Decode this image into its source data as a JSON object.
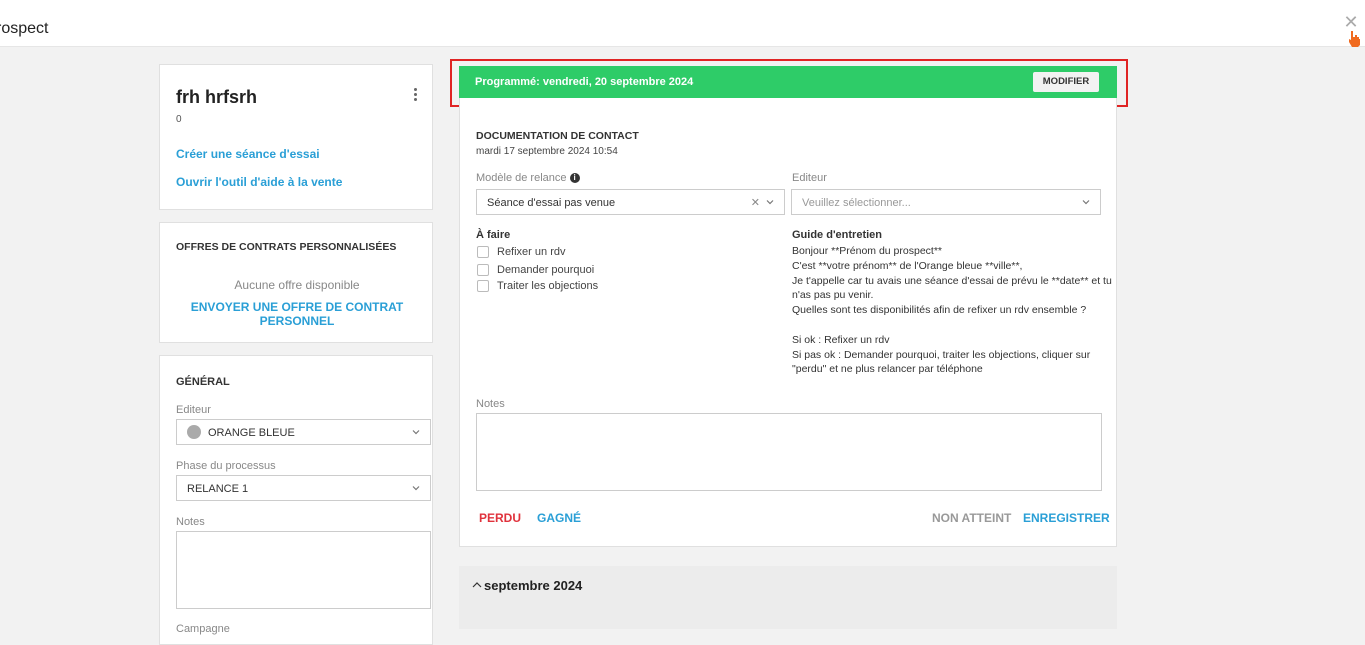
{
  "header": {
    "title": "rospect"
  },
  "profile": {
    "name": "frh hrfsrh",
    "sub": "0",
    "link_trial": "Créer une séance d'essai",
    "link_sales": "Ouvrir l'outil d'aide à la vente"
  },
  "offers": {
    "title": "OFFRES DE CONTRATS PERSONNALISÉES",
    "empty": "Aucune offre disponible",
    "send": "ENVOYER UNE OFFRE DE CONTRAT PERSONNEL"
  },
  "general": {
    "title": "GÉNÉRAL",
    "editor_label": "Editeur",
    "editor_value": "ORANGE BLEUE",
    "phase_label": "Phase du processus",
    "phase_value": "RELANCE 1",
    "notes_label": "Notes",
    "campaign_label": "Campagne"
  },
  "banner": {
    "text": "Programmé: vendredi, 20 septembre 2024",
    "button": "MODIFIER",
    "color": "#2ecc68",
    "highlight": "#e02424"
  },
  "contact": {
    "title": "DOCUMENTATION DE CONTACT",
    "date": "mardi 17 septembre 2024 10:54",
    "template_label": "Modèle de relance",
    "template_value": "Séance d'essai pas venue",
    "editor_label": "Editeur",
    "editor_placeholder": "Veuillez sélectionner...",
    "todo_title": "À faire",
    "todo": [
      "Refixer un rdv",
      "Demander pourquoi",
      "Traiter les objections"
    ],
    "guide_title": "Guide d'entretien",
    "guide": [
      "Bonjour **Prénom du prospect**",
      "C'est **votre prénom** de l'Orange bleue **ville**,",
      "Je t'appelle car tu avais une séance d'essai de prévu le **date** et tu",
      "n'as pas pu venir.",
      "Quelles sont tes disponibilités afin de refixer un rdv ensemble ?",
      "",
      "Si ok : Refixer un rdv",
      "Si pas ok : Demander pourquoi, traiter les objections, cliquer sur",
      "\"perdu\" et ne plus relancer par téléphone"
    ],
    "notes_label": "Notes",
    "lost": "PERDU",
    "won": "GAGNÉ",
    "not_reached": "NON ATTEINT",
    "save": "ENREGISTRER",
    "lost_color": "#e0323c",
    "link_color": "#2a9fd6"
  },
  "timeline": {
    "month": "septembre 2024"
  }
}
